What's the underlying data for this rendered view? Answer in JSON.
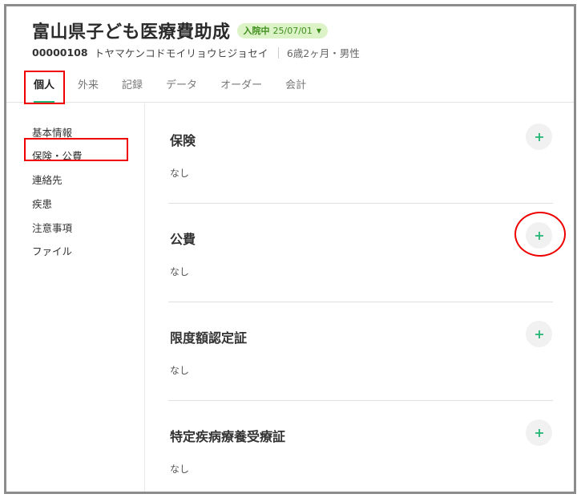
{
  "header": {
    "title": "富山県子ども医療費助成",
    "status_badge": {
      "label": "入院中",
      "date": "25/07/01"
    },
    "patient_id": "00000108",
    "patient_kana": "トヤマケンコドモイリョウヒジョセイ",
    "age_gender": "6歳2ヶ月・男性"
  },
  "tabs": [
    {
      "label": "個人",
      "active": true
    },
    {
      "label": "外来"
    },
    {
      "label": "記録"
    },
    {
      "label": "データ"
    },
    {
      "label": "オーダー"
    },
    {
      "label": "会計"
    }
  ],
  "sidebar": {
    "items": [
      {
        "label": "基本情報"
      },
      {
        "label": "保険・公費",
        "selected": true
      },
      {
        "label": "連絡先"
      },
      {
        "label": "疾患"
      },
      {
        "label": "注意事項"
      },
      {
        "label": "ファイル"
      }
    ]
  },
  "sections": [
    {
      "title": "保険",
      "empty_text": "なし"
    },
    {
      "title": "公費",
      "empty_text": "なし"
    },
    {
      "title": "限度額認定証",
      "empty_text": "なし"
    },
    {
      "title": "特定疾病療養受療証",
      "empty_text": "なし"
    }
  ],
  "colors": {
    "accent": "#21b573",
    "highlight": "#e00000",
    "badge_bg": "#dcf3c8",
    "badge_text": "#3f8e1d"
  },
  "icons": {
    "add": "plus-icon",
    "badge_caret": "caret-down-icon"
  }
}
